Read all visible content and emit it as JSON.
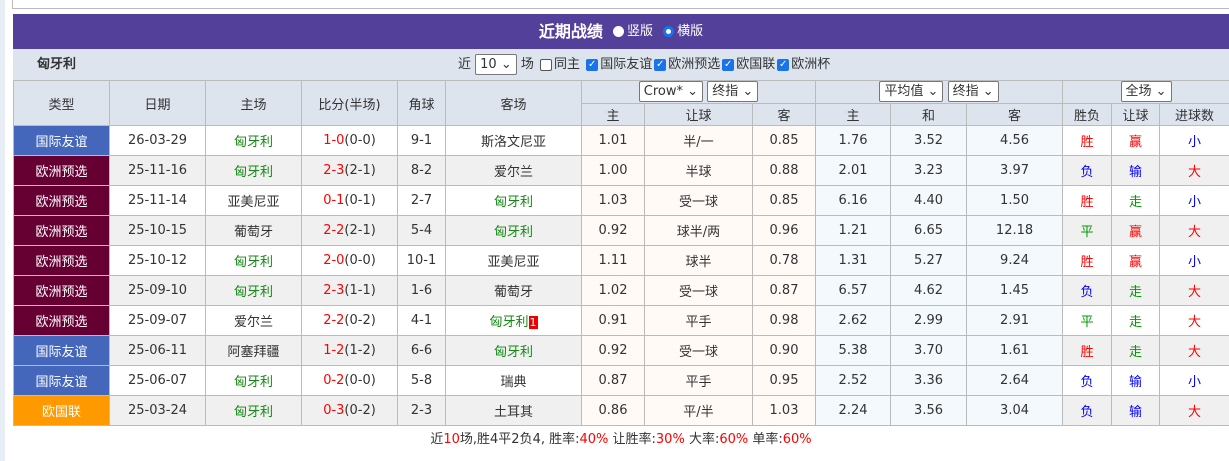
{
  "title": "近期战绩",
  "view_options": [
    "竖版",
    "横版"
  ],
  "view_selected": "横版",
  "team": "匈牙利",
  "filter": {
    "prefix": "近",
    "count": "10",
    "suffix": "场",
    "same_home": "同主",
    "leagues": [
      "国际友谊",
      "欧洲预选",
      "欧国联",
      "欧洲杯"
    ]
  },
  "headers": {
    "type": "类型",
    "date": "日期",
    "home": "主场",
    "score": "比分(半场)",
    "corner": "角球",
    "away": "客场",
    "asia_company": "Crow*",
    "asia_kind": "终指",
    "euro_company": "平均值",
    "euro_kind": "终指",
    "scope": "全场",
    "asia_cols": [
      "主",
      "让球",
      "客"
    ],
    "euro_cols": [
      "主",
      "和",
      "客"
    ],
    "result_cols": [
      "胜负",
      "让球",
      "进球数"
    ]
  },
  "colors": {
    "国际友谊": "#4466bb",
    "欧洲预选": "#660033",
    "欧国联": "#ff9900",
    "win": "#ff0000",
    "lose": "#0000ff",
    "draw": "#009900",
    "team": "#118811"
  },
  "rows": [
    {
      "type": "国际友谊",
      "date": "26-03-29",
      "home": "匈牙利",
      "ft": "1-0",
      "ht": "(0-0)",
      "corner": "9-1",
      "away": "斯洛文尼亚",
      "a1": "1.01",
      "line": "半/一",
      "a2": "0.85",
      "e1": "1.76",
      "ed": "3.52",
      "e2": "4.56",
      "wl": "胜",
      "hc": "赢",
      "ou": "小"
    },
    {
      "type": "欧洲预选",
      "date": "25-11-16",
      "home": "匈牙利",
      "ft": "2-3",
      "ht": "(2-1)",
      "corner": "8-2",
      "away": "爱尔兰",
      "a1": "1.00",
      "line": "半球",
      "a2": "0.88",
      "e1": "2.01",
      "ed": "3.23",
      "e2": "3.97",
      "wl": "负",
      "hc": "输",
      "ou": "大"
    },
    {
      "type": "欧洲预选",
      "date": "25-11-14",
      "home": "亚美尼亚",
      "ft": "0-1",
      "ht": "(0-1)",
      "corner": "2-7",
      "away": "匈牙利",
      "a1": "1.03",
      "line": "受一球",
      "a2": "0.85",
      "e1": "6.16",
      "ed": "4.40",
      "e2": "1.50",
      "wl": "胜",
      "hc": "走",
      "ou": "小"
    },
    {
      "type": "欧洲预选",
      "date": "25-10-15",
      "home": "葡萄牙",
      "ft": "2-2",
      "ht": "(2-1)",
      "corner": "5-4",
      "away": "匈牙利",
      "a1": "0.92",
      "line": "球半/两",
      "a2": "0.96",
      "e1": "1.21",
      "ed": "6.65",
      "e2": "12.18",
      "wl": "平",
      "hc": "赢",
      "ou": "大"
    },
    {
      "type": "欧洲预选",
      "date": "25-10-12",
      "home": "匈牙利",
      "ft": "2-0",
      "ht": "(0-0)",
      "corner": "10-1",
      "away": "亚美尼亚",
      "a1": "1.11",
      "line": "球半",
      "a2": "0.78",
      "e1": "1.31",
      "ed": "5.27",
      "e2": "9.24",
      "wl": "胜",
      "hc": "赢",
      "ou": "小"
    },
    {
      "type": "欧洲预选",
      "date": "25-09-10",
      "home": "匈牙利",
      "ft": "2-3",
      "ht": "(1-1)",
      "corner": "1-6",
      "away": "葡萄牙",
      "a1": "1.02",
      "line": "受一球",
      "a2": "0.87",
      "e1": "6.57",
      "ed": "4.62",
      "e2": "1.45",
      "wl": "负",
      "hc": "走",
      "ou": "大"
    },
    {
      "type": "欧洲预选",
      "date": "25-09-07",
      "home": "爱尔兰",
      "ft": "2-2",
      "ht": "(0-2)",
      "corner": "4-1",
      "away": "匈牙利",
      "badge": "1",
      "a1": "0.91",
      "line": "平手",
      "a2": "0.98",
      "e1": "2.62",
      "ed": "2.99",
      "e2": "2.91",
      "wl": "平",
      "hc": "走",
      "ou": "大"
    },
    {
      "type": "国际友谊",
      "date": "25-06-11",
      "home": "阿塞拜疆",
      "ft": "1-2",
      "ht": "(1-2)",
      "corner": "6-6",
      "away": "匈牙利",
      "a1": "0.92",
      "line": "受一球",
      "a2": "0.90",
      "e1": "5.38",
      "ed": "3.70",
      "e2": "1.61",
      "wl": "胜",
      "hc": "走",
      "ou": "大"
    },
    {
      "type": "国际友谊",
      "date": "25-06-07",
      "home": "匈牙利",
      "ft": "0-2",
      "ht": "(0-0)",
      "corner": "5-8",
      "away": "瑞典",
      "a1": "0.87",
      "line": "平手",
      "a2": "0.95",
      "e1": "2.52",
      "ed": "3.36",
      "e2": "2.64",
      "wl": "负",
      "hc": "输",
      "ou": "小"
    },
    {
      "type": "欧国联",
      "date": "25-03-24",
      "home": "匈牙利",
      "ft": "0-3",
      "ht": "(0-2)",
      "corner": "2-3",
      "away": "土耳其",
      "a1": "0.86",
      "line": "平/半",
      "a2": "1.03",
      "e1": "2.24",
      "ed": "3.56",
      "e2": "3.04",
      "wl": "负",
      "hc": "输",
      "ou": "大"
    }
  ],
  "summary": {
    "p1": "近",
    "n": "10",
    "p2": "场,胜4平2负4, 胜率:",
    "win_rate": "40%",
    "p3": " 让胜率:",
    "hc_rate": "30%",
    "p4": " 大率:",
    "over_rate": "60%",
    "p5": " 单率:",
    "odd_rate": "60%"
  }
}
